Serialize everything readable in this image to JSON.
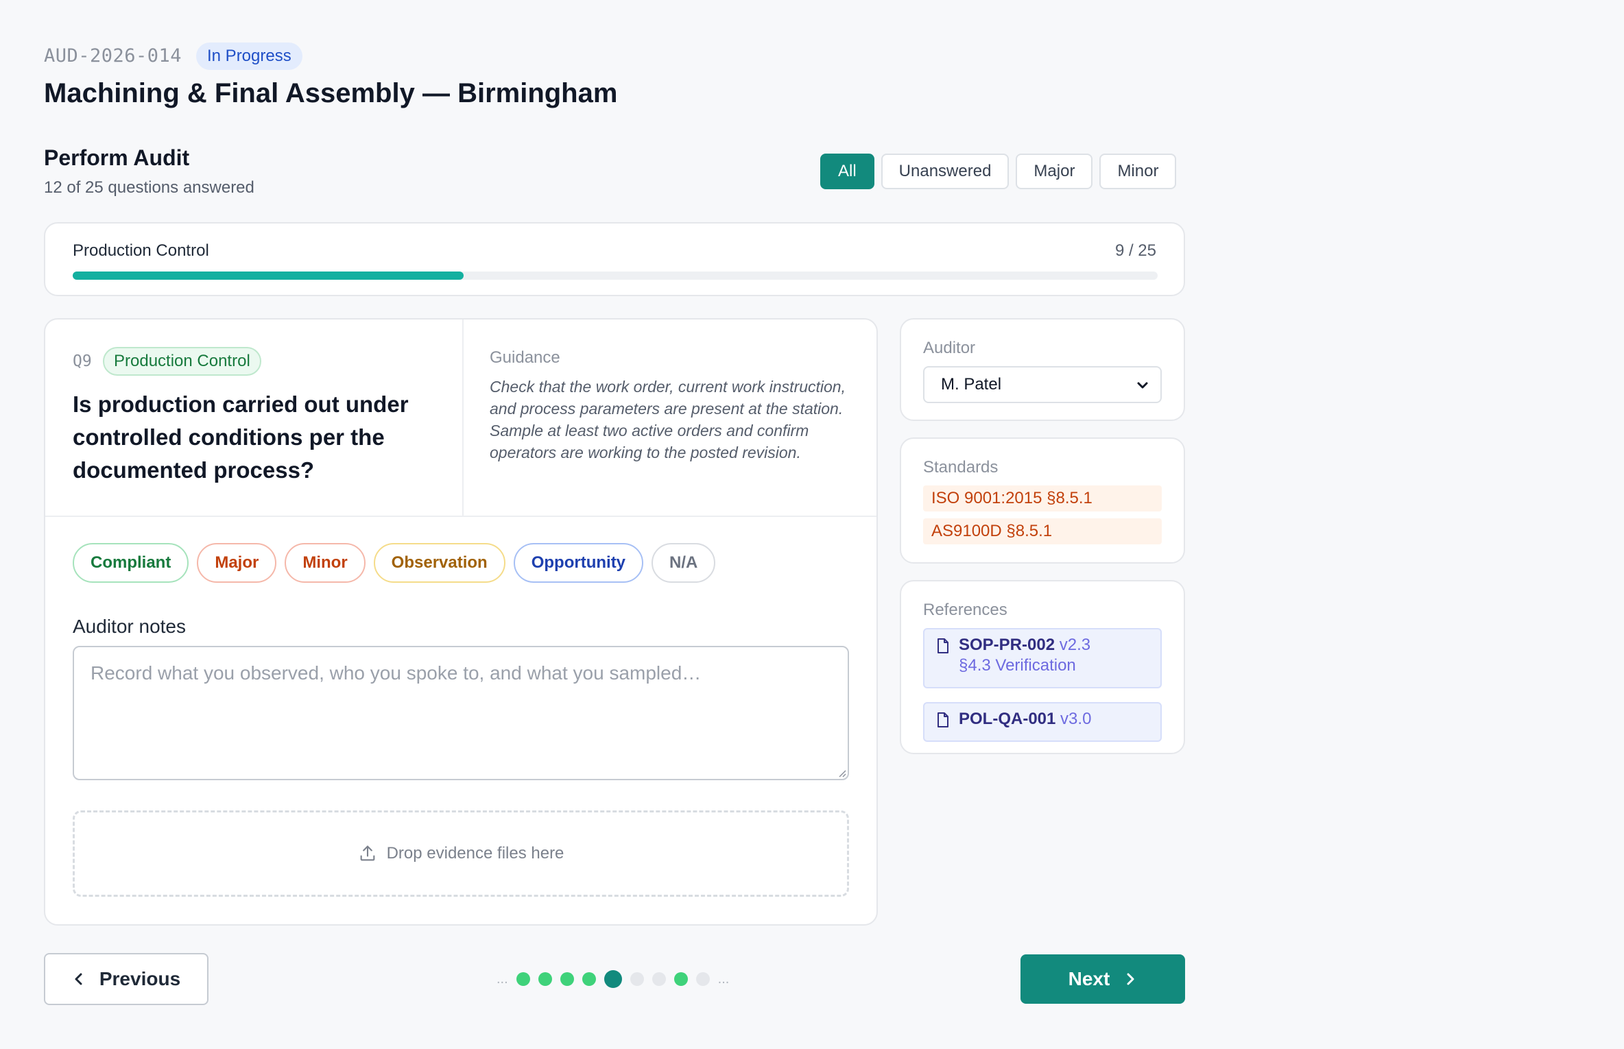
{
  "header": {
    "audit_id": "AUD-2026-014",
    "status": "In Progress",
    "title": "Machining & Final Assembly — Birmingham"
  },
  "section": {
    "title": "Perform Audit",
    "subtitle": "12 of 25 questions answered"
  },
  "filters": [
    {
      "label": "All",
      "active": true
    },
    {
      "label": "Unanswered",
      "active": false
    },
    {
      "label": "Major",
      "active": false
    },
    {
      "label": "Minor",
      "active": false
    }
  ],
  "progress": {
    "label": "Production Control",
    "count": "9 / 25",
    "fraction": 0.36
  },
  "question": {
    "number": "Q9",
    "category": "Production Control",
    "text": "Is production carried out under controlled conditions per the documented process?",
    "guidance_title": "Guidance",
    "guidance": "Check that the work order, current work instruction, and process parameters are present at the station. Sample at least two active orders and confirm operators are working to the posted revision."
  },
  "ratings": [
    "Compliant",
    "Major",
    "Minor",
    "Observation",
    "Opportunity",
    "N/A"
  ],
  "notes": {
    "label": "Auditor notes",
    "placeholder": "Record what you observed, who you spoke to, and what you sampled…",
    "value": ""
  },
  "dropzone": {
    "label": "Drop evidence files here",
    "icon": "upload-icon"
  },
  "auditor": {
    "title": "Auditor",
    "selected": "M. Patel"
  },
  "standards": {
    "title": "Standards",
    "items": [
      "ISO 9001:2015 §8.5.1",
      "AS9100D §8.5.1"
    ]
  },
  "references": {
    "title": "References",
    "items": [
      {
        "code": "SOP-PR-002",
        "version": "v2.3",
        "section": "§4.3 Verification",
        "icon": "document-icon"
      },
      {
        "code": "POL-QA-001",
        "version": "v3.0",
        "section": "",
        "icon": "document-icon"
      }
    ]
  },
  "nav": {
    "previous": "Previous",
    "next": "Next",
    "pager": [
      "answered",
      "answered",
      "answered",
      "answered",
      "current",
      "empty",
      "empty",
      "answered",
      "empty"
    ]
  },
  "colors": {
    "accent": "#128a7d",
    "progress": "#14b0a0",
    "answered_dot": "#3fd27a",
    "status_bg": "#e3ecfd",
    "status_text": "#1f4fc7"
  }
}
